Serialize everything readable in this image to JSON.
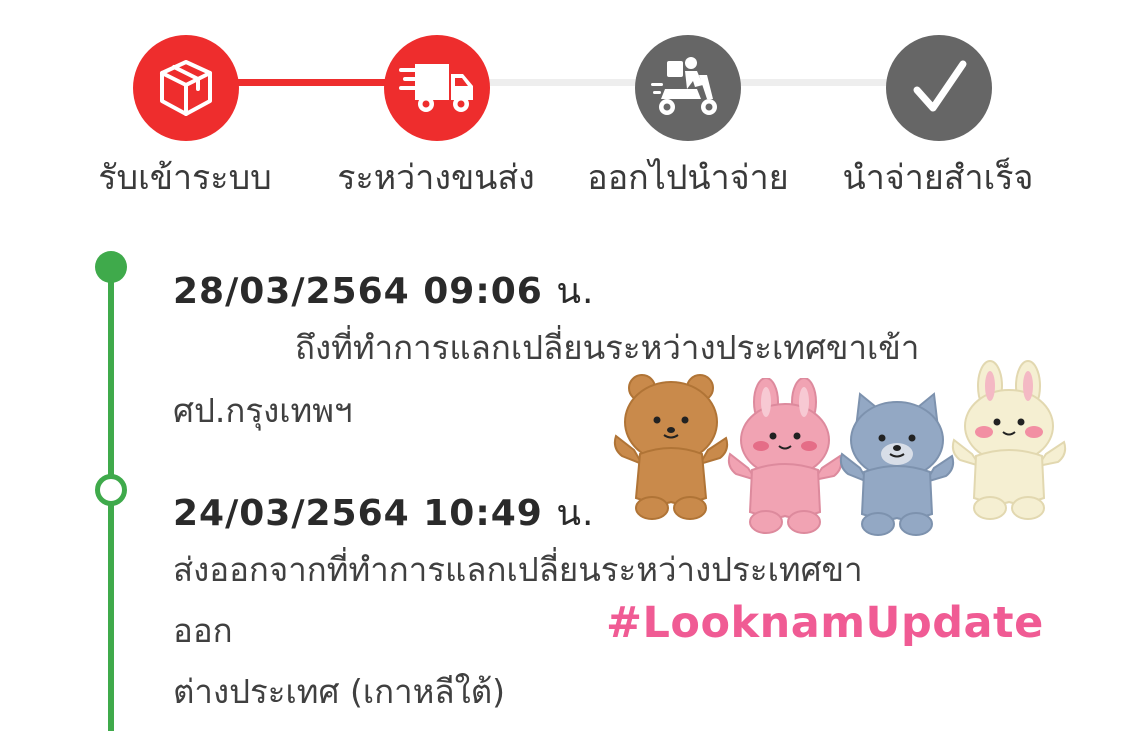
{
  "colors": {
    "accent": "#ee2d2d",
    "inactive": "#666666",
    "track_inactive": "#eeeeee",
    "timeline": "#3faa4b",
    "hashtag": "#f05b94"
  },
  "steps": [
    {
      "label": "รับเข้าระบบ",
      "icon": "package-box-icon",
      "state": "done"
    },
    {
      "label": "ระหว่างขนส่ง",
      "icon": "delivery-truck-icon",
      "state": "current"
    },
    {
      "label": "ออกไปนำจ่าย",
      "icon": "delivery-scooter-icon",
      "state": "pending"
    },
    {
      "label": "นำจ่ายสำเร็จ",
      "icon": "checkmark-icon",
      "state": "pending"
    }
  ],
  "events": [
    {
      "date": "28/03/2564 09:06",
      "unit": "น.",
      "lines": [
        "ถึงที่ทำการแลกเปลี่ยนระหว่างประเทศขาเข้า",
        "ศป.กรุงเทพฯ"
      ]
    },
    {
      "date": "24/03/2564 10:49",
      "unit": "น.",
      "lines": [
        "ส่งออกจากที่ทำการแลกเปลี่ยนระหว่างประเทศขา",
        "ออก",
        "ต่างประเทศ (เกาหลีใต้)"
      ]
    }
  ],
  "overlay": {
    "hashtag": "#LooknamUpdate",
    "stickers": [
      "brown-bear-sticker",
      "pink-bunny-sticker",
      "blue-cat-sticker",
      "cream-bunny-sticker"
    ]
  }
}
